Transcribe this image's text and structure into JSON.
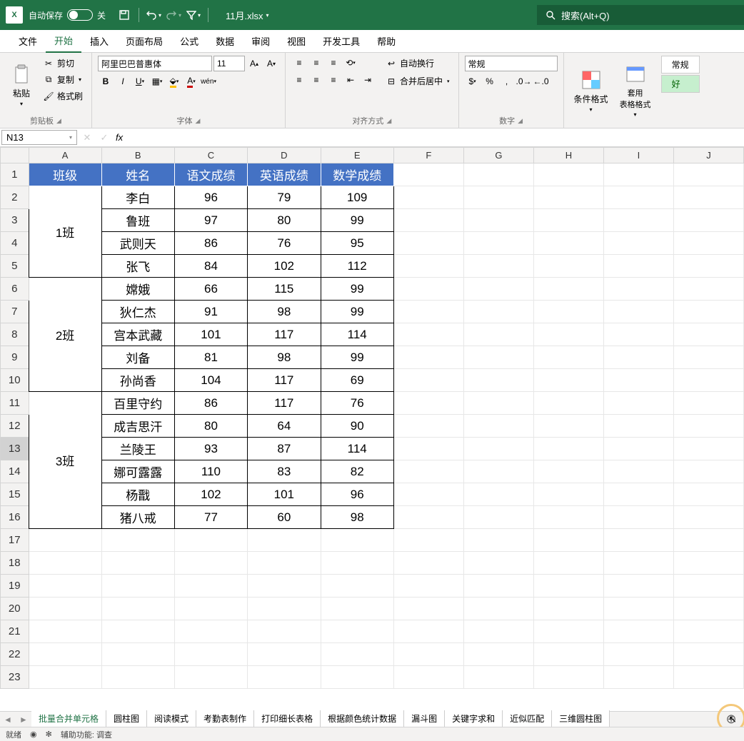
{
  "titlebar": {
    "autosave_label": "自动保存",
    "autosave_state": "关",
    "filename": "11月.xlsx",
    "search_placeholder": "搜索(Alt+Q)"
  },
  "ribbon_tabs": [
    "文件",
    "开始",
    "插入",
    "页面布局",
    "公式",
    "数据",
    "审阅",
    "视图",
    "开发工具",
    "帮助"
  ],
  "active_tab_index": 1,
  "clipboard": {
    "paste": "粘贴",
    "cut": "剪切",
    "copy": "复制",
    "format_painter": "格式刷",
    "group_label": "剪贴板"
  },
  "font": {
    "name": "阿里巴巴普惠体",
    "size": "11",
    "group_label": "字体"
  },
  "alignment": {
    "wrap": "自动换行",
    "merge": "合并后居中",
    "group_label": "对齐方式"
  },
  "number": {
    "format": "常规",
    "group_label": "数字"
  },
  "styles": {
    "conditional": "条件格式",
    "table_format": "套用\n表格格式",
    "normal": "常规",
    "good": "好"
  },
  "namebox": "N13",
  "columns": [
    "A",
    "B",
    "C",
    "D",
    "E",
    "F",
    "G",
    "H",
    "I",
    "J"
  ],
  "row_count": 23,
  "table": {
    "headers": [
      "班级",
      "姓名",
      "语文成绩",
      "英语成绩",
      "数学成绩"
    ],
    "groups": [
      {
        "class": "1班",
        "rows": [
          [
            "李白",
            "96",
            "79",
            "109"
          ],
          [
            "鲁班",
            "97",
            "80",
            "99"
          ],
          [
            "武则天",
            "86",
            "76",
            "95"
          ],
          [
            "张飞",
            "84",
            "102",
            "112"
          ]
        ]
      },
      {
        "class": "2班",
        "rows": [
          [
            "嫦娥",
            "66",
            "115",
            "99"
          ],
          [
            "狄仁杰",
            "91",
            "98",
            "99"
          ],
          [
            "宫本武藏",
            "101",
            "117",
            "114"
          ],
          [
            "刘备",
            "81",
            "98",
            "99"
          ],
          [
            "孙尚香",
            "104",
            "117",
            "69"
          ]
        ]
      },
      {
        "class": "3班",
        "rows": [
          [
            "百里守约",
            "86",
            "117",
            "76"
          ],
          [
            "成吉思汗",
            "80",
            "64",
            "90"
          ],
          [
            "兰陵王",
            "93",
            "87",
            "114"
          ],
          [
            "娜可露露",
            "110",
            "83",
            "82"
          ],
          [
            "杨戬",
            "102",
            "101",
            "96"
          ],
          [
            "猪八戒",
            "77",
            "60",
            "98"
          ]
        ]
      }
    ]
  },
  "sheet_tabs": [
    "批量合并单元格",
    "圆柱图",
    "阅读模式",
    "考勤表制作",
    "打印细长表格",
    "根据颜色统计数据",
    "漏斗图",
    "关键字求和",
    "近似匹配",
    "三维圆柱图"
  ],
  "active_sheet_index": 0,
  "statusbar": {
    "ready": "就绪",
    "accessibility": "辅助功能: 调查"
  }
}
